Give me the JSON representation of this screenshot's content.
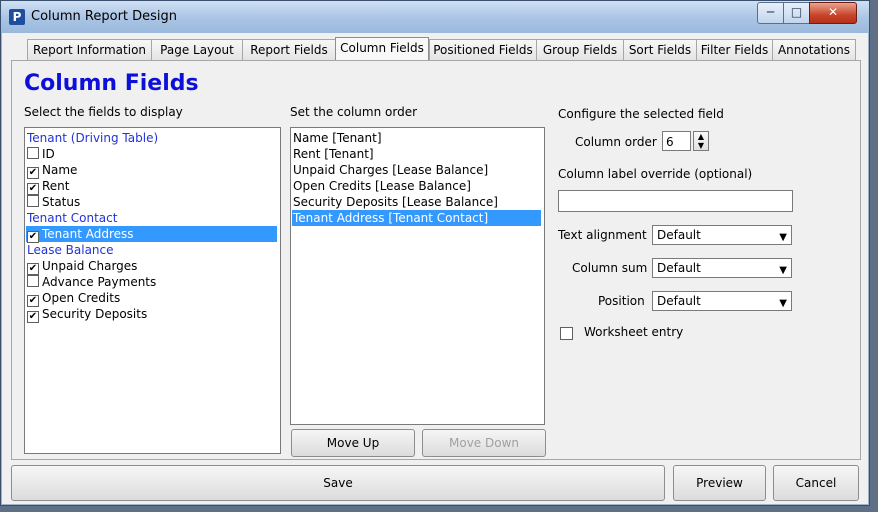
{
  "window": {
    "title": "Column Report Design",
    "app_icon": "P"
  },
  "tabs": [
    {
      "label": "Report Information"
    },
    {
      "label": "Page Layout"
    },
    {
      "label": "Report Fields"
    },
    {
      "label": "Column Fields"
    },
    {
      "label": "Positioned Fields"
    },
    {
      "label": "Group Fields"
    },
    {
      "label": "Sort Fields"
    },
    {
      "label": "Filter Fields"
    },
    {
      "label": "Annotations"
    }
  ],
  "heading": "Column Fields",
  "fields_panel": {
    "label": "Select the fields to display",
    "items": [
      {
        "type": "group",
        "label": "Tenant (Driving Table)"
      },
      {
        "type": "field",
        "label": "ID",
        "checked": false
      },
      {
        "type": "field",
        "label": "Name",
        "checked": true
      },
      {
        "type": "field",
        "label": "Rent",
        "checked": true
      },
      {
        "type": "field",
        "label": "Status",
        "checked": false
      },
      {
        "type": "group",
        "label": "Tenant Contact"
      },
      {
        "type": "field",
        "label": "Tenant Address",
        "checked": true,
        "selected": true
      },
      {
        "type": "group",
        "label": "Lease Balance"
      },
      {
        "type": "field",
        "label": "Unpaid Charges",
        "checked": true
      },
      {
        "type": "field",
        "label": "Advance Payments",
        "checked": false
      },
      {
        "type": "field",
        "label": "Open Credits",
        "checked": true
      },
      {
        "type": "field",
        "label": "Security Deposits",
        "checked": true
      }
    ]
  },
  "order_panel": {
    "label": "Set the column order",
    "items": [
      "Name [Tenant]",
      "Rent [Tenant]",
      "Unpaid Charges [Lease Balance]",
      "Open Credits [Lease Balance]",
      "Security Deposits [Lease Balance]",
      "Tenant Address [Tenant Contact]"
    ],
    "move_up": "Move Up",
    "move_down": "Move Down"
  },
  "config": {
    "label": "Configure the selected field",
    "column_order_label": "Column order",
    "column_order_value": "6",
    "override_label": "Column label override (optional)",
    "override_value": "",
    "text_alignment_label": "Text alignment",
    "text_alignment_value": "Default",
    "column_sum_label": "Column sum",
    "column_sum_value": "Default",
    "position_label": "Position",
    "position_value": "Default",
    "worksheet_label": "Worksheet entry"
  },
  "footer": {
    "save": "Save",
    "preview": "Preview",
    "cancel": "Cancel"
  },
  "colors": {
    "heading": "#0d10d8",
    "selection": "#3399ff",
    "group_text": "#2333d6"
  }
}
